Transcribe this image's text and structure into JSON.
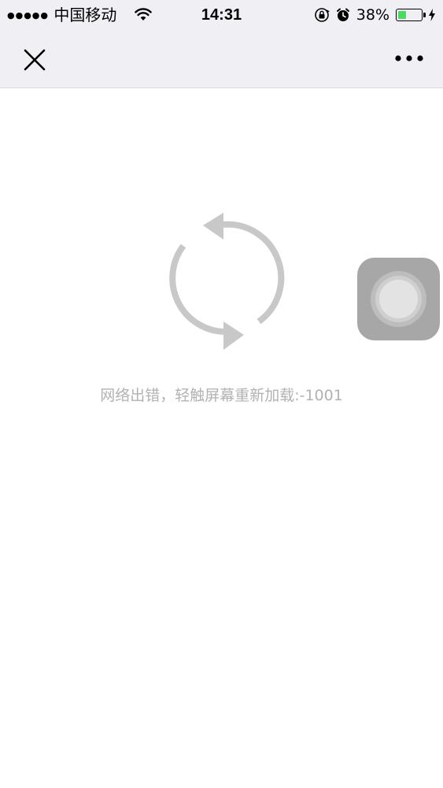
{
  "status_bar": {
    "signal_dots": "●●●●●",
    "carrier": "中国移动",
    "time": "14:31",
    "battery_percent": "38%",
    "battery_level": 0.38,
    "battery_fill_color": "#4cd964",
    "icons": [
      "wifi-icon",
      "orientation-lock-icon",
      "alarm-icon",
      "battery-icon",
      "charging-icon"
    ]
  },
  "nav": {
    "close_icon": "close-icon",
    "more_icon": "more-icon"
  },
  "error": {
    "icon": "refresh-icon",
    "message": "网络出错，轻触屏幕重新加载:-1001",
    "text_color": "#b2b2b2"
  },
  "assistive_touch": {
    "icon": "assistive-touch-icon"
  }
}
